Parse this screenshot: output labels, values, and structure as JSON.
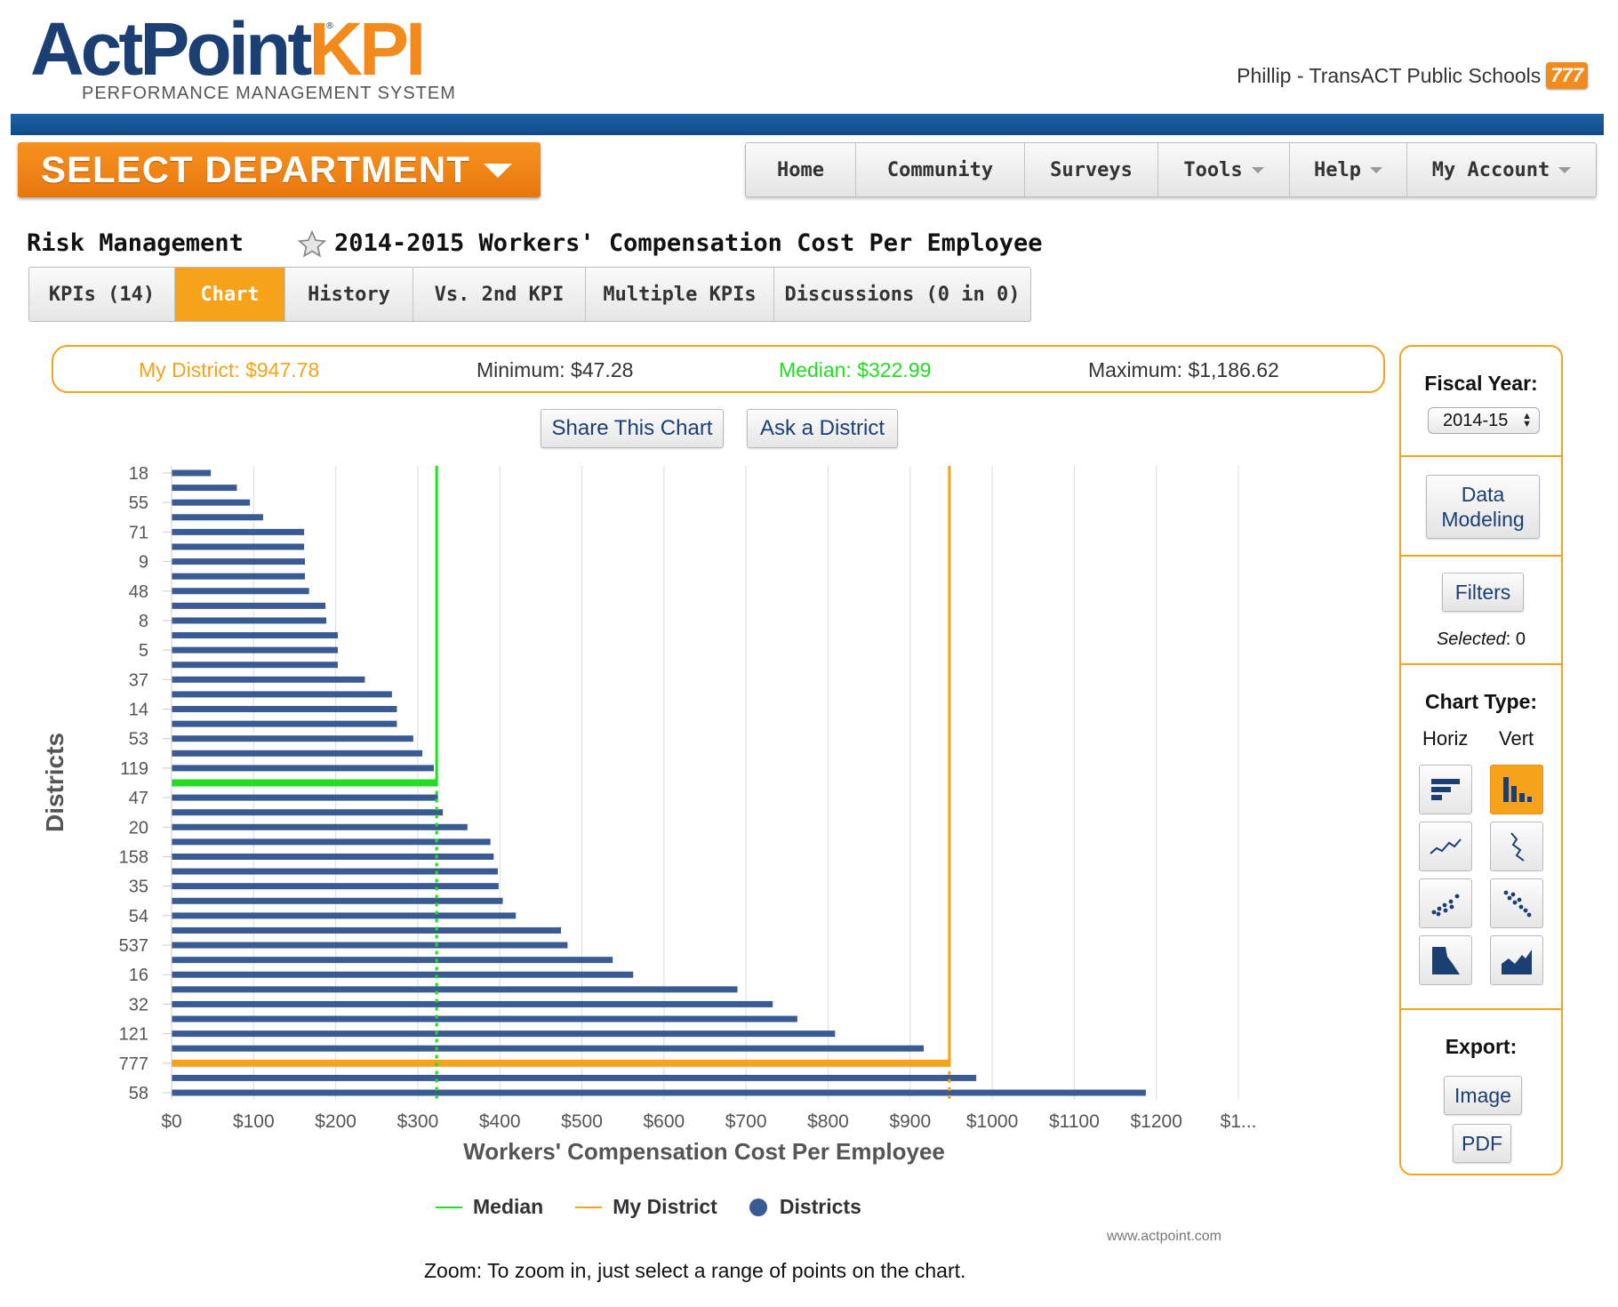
{
  "header": {
    "logo_brand_a": "ActPoint",
    "logo_brand_b": "KPI",
    "logo_tm": "®",
    "logo_tagline": "PERFORMANCE MANAGEMENT SYSTEM",
    "user_text": "Phillip - TransACT Public Schools",
    "user_badge": "777"
  },
  "department_select": {
    "label": "SELECT DEPARTMENT"
  },
  "nav": {
    "items": [
      {
        "label": "Home",
        "dropdown": false
      },
      {
        "label": "Community",
        "dropdown": false
      },
      {
        "label": "Surveys",
        "dropdown": false
      },
      {
        "label": "Tools",
        "dropdown": true
      },
      {
        "label": "Help",
        "dropdown": true
      },
      {
        "label": "My Account",
        "dropdown": true
      }
    ]
  },
  "page": {
    "department": "Risk Management",
    "kpi_title": "2014-2015 Workers' Compensation Cost Per Employee"
  },
  "tabs": [
    {
      "label": "KPIs (14)",
      "active": false
    },
    {
      "label": "Chart",
      "active": true
    },
    {
      "label": "History",
      "active": false
    },
    {
      "label": "Vs. 2nd KPI",
      "active": false
    },
    {
      "label": "Multiple KPIs",
      "active": false
    },
    {
      "label": "Discussions (0 in 0)",
      "active": false
    }
  ],
  "stats": {
    "my_district": "My District: $947.78",
    "minimum": "Minimum: $47.28",
    "median": "Median: $322.99",
    "maximum": "Maximum: $1,186.62"
  },
  "actions": {
    "share": "Share This Chart",
    "ask": "Ask a District"
  },
  "chart_data": {
    "type": "bar",
    "orientation": "horizontal",
    "xlabel": "Workers' Compensation Cost Per Employee",
    "ylabel": "Districts",
    "xlim": [
      0,
      1300
    ],
    "x_tick_labels": [
      "$0",
      "$100",
      "$200",
      "$300",
      "$400",
      "$500",
      "$600",
      "$700",
      "$800",
      "$900",
      "$1000",
      "$1100",
      "$1200",
      "$1..."
    ],
    "y_tick_labels": [
      "18",
      "55",
      "71",
      "9",
      "48",
      "8",
      "5",
      "37",
      "14",
      "53",
      "119",
      "47",
      "20",
      "158",
      "35",
      "54",
      "537",
      "16",
      "32",
      "121",
      "777",
      "58"
    ],
    "grid": "vertical",
    "values": [
      47.28,
      79,
      95,
      111,
      161,
      161,
      162,
      162,
      167,
      187,
      188,
      202,
      202,
      202,
      235,
      268,
      274,
      274,
      294,
      305,
      319,
      322.99,
      324,
      330,
      360,
      388,
      392,
      397,
      398,
      403,
      419,
      474,
      482,
      537,
      562,
      689,
      732,
      762,
      808,
      916,
      947.78,
      980,
      1186.62
    ],
    "highlights": {
      "median_index": 21,
      "my_district_index": 40
    },
    "reference_lines": [
      {
        "name": "Median",
        "value": 322.99,
        "color": "#22dd22"
      },
      {
        "name": "My District",
        "value": 947.78,
        "color": "#f7a21b"
      }
    ],
    "series_color": "#3a5a93",
    "legend": [
      "Median",
      "My District",
      "Districts"
    ],
    "legend_placement": "bottom"
  },
  "legend": {
    "median": "Median",
    "my_district": "My District",
    "districts": "Districts"
  },
  "colors": {
    "accent": "#f7a21b",
    "median": "#22dd22",
    "bars": "#3a5a93",
    "brand_blue": "#1b3f73"
  },
  "footer": {
    "credit": "www.actpoint.com",
    "zoom_note": "Zoom: To zoom in, just select a range of points on the chart."
  },
  "side_panel": {
    "fiscal_year_label": "Fiscal Year:",
    "fiscal_year_value": "2014-15",
    "data_modeling": "Data Modeling",
    "filters": "Filters",
    "selected_label": "Selected",
    "selected_count": "0",
    "chart_type_label": "Chart Type:",
    "horiz": "Horiz",
    "vert": "Vert",
    "chart_types": [
      "bar-horizontal-icon",
      "bar-vertical-icon",
      "line-horizontal-icon",
      "line-vertical-icon",
      "scatter-horizontal-icon",
      "scatter-vertical-icon",
      "area-horizontal-icon",
      "area-vertical-icon"
    ],
    "export_label": "Export:",
    "export_image": "Image",
    "export_pdf": "PDF"
  }
}
